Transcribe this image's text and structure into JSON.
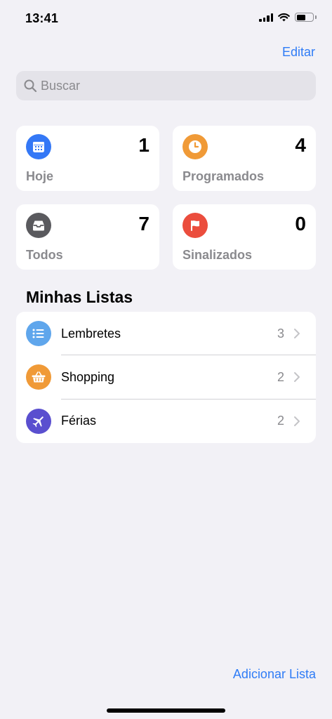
{
  "status_bar": {
    "time": "13:41",
    "battery_level": 0.6
  },
  "header": {
    "edit_label": "Editar"
  },
  "search": {
    "placeholder": "Buscar"
  },
  "smart_lists": [
    {
      "label": "Hoje",
      "count": "1",
      "icon": "calendar-icon",
      "color": "#3478f6"
    },
    {
      "label": "Programados",
      "count": "4",
      "icon": "clock-icon",
      "color": "#f09a37"
    },
    {
      "label": "Todos",
      "count": "7",
      "icon": "tray-icon",
      "color": "#5a5a5e"
    },
    {
      "label": "Sinalizados",
      "count": "0",
      "icon": "flag-icon",
      "color": "#eb4d3d"
    }
  ],
  "my_lists": {
    "title": "Minhas Listas",
    "items": [
      {
        "name": "Lembretes",
        "count": "3",
        "icon": "list-bullet-icon",
        "color": "#5fa6ec"
      },
      {
        "name": "Shopping",
        "count": "2",
        "icon": "basket-icon",
        "color": "#f09a37"
      },
      {
        "name": "Férias",
        "count": "2",
        "icon": "airplane-icon",
        "color": "#5a4fcf"
      }
    ]
  },
  "footer": {
    "add_list_label": "Adicionar Lista"
  }
}
